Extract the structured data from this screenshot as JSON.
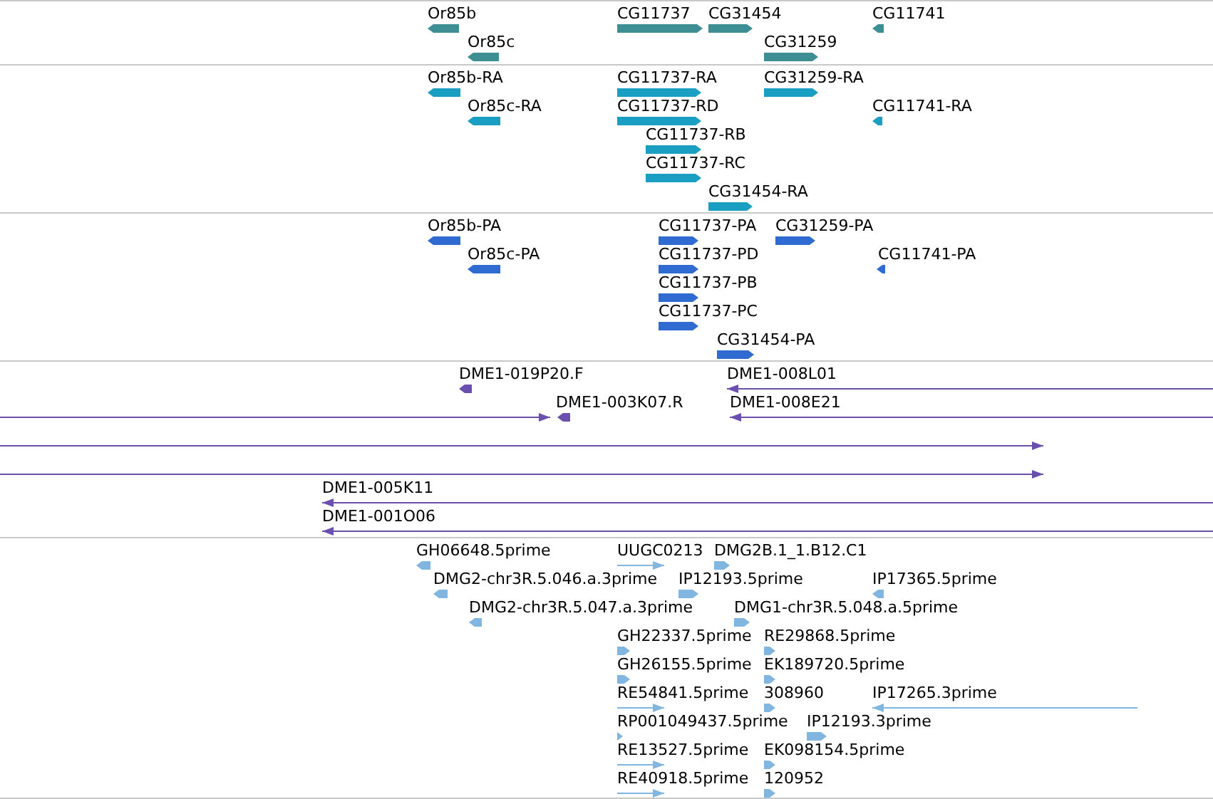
{
  "tracks": [
    {
      "kind": "gene",
      "features": [
        {
          "label": "Or85b",
          "kind": "block",
          "reverse": true
        },
        {
          "label": "Or85c",
          "kind": "block",
          "reverse": true
        },
        {
          "label": "CG11737",
          "kind": "block",
          "reverse": false
        },
        {
          "label": "CG31454",
          "kind": "block",
          "reverse": false
        },
        {
          "label": "CG31259",
          "kind": "block",
          "reverse": false
        },
        {
          "label": "CG11741",
          "kind": "block",
          "reverse": true
        }
      ]
    },
    {
      "kind": "transcript",
      "features": [
        {
          "label": "Or85b-RA",
          "kind": "block",
          "reverse": true
        },
        {
          "label": "CG11737-RA",
          "kind": "block",
          "reverse": false
        },
        {
          "label": "CG31259-RA",
          "kind": "block",
          "reverse": false
        },
        {
          "label": "Or85c-RA",
          "kind": "block",
          "reverse": true
        },
        {
          "label": "CG11737-RD",
          "kind": "block",
          "reverse": false
        },
        {
          "label": "CG11741-RA",
          "kind": "block",
          "reverse": true
        },
        {
          "label": "CG11737-RB",
          "kind": "block",
          "reverse": false
        },
        {
          "label": "CG11737-RC",
          "kind": "block",
          "reverse": false
        },
        {
          "label": "CG31454-RA",
          "kind": "block",
          "reverse": false
        }
      ]
    },
    {
      "kind": "protein",
      "features": [
        {
          "label": "Or85b-PA",
          "kind": "block",
          "reverse": true
        },
        {
          "label": "CG11737-PA",
          "kind": "block",
          "reverse": false
        },
        {
          "label": "CG31259-PA",
          "kind": "block",
          "reverse": false
        },
        {
          "label": "Or85c-PA",
          "kind": "block",
          "reverse": true
        },
        {
          "label": "CG11737-PD",
          "kind": "block",
          "reverse": false
        },
        {
          "label": "CG11741-PA",
          "kind": "block",
          "reverse": true
        },
        {
          "label": "CG11737-PB",
          "kind": "block",
          "reverse": false
        },
        {
          "label": "CG11737-PC",
          "kind": "block",
          "reverse": false
        },
        {
          "label": "CG31454-PA",
          "kind": "block",
          "reverse": false
        }
      ]
    },
    {
      "kind": "clone",
      "features": [
        {
          "label": "DME1-019P20.F",
          "kind": "block",
          "reverse": true
        },
        {
          "label": "DME1-008L01",
          "kind": "line",
          "reverse": true
        },
        {
          "kind": "line",
          "reverse": false
        },
        {
          "label": "DME1-003K07.R",
          "kind": "block",
          "reverse": true
        },
        {
          "label": "DME1-008E21",
          "kind": "line",
          "reverse": true
        },
        {
          "kind": "line",
          "reverse": false
        },
        {
          "kind": "line",
          "reverse": false
        },
        {
          "label": "DME1-005K11",
          "kind": "line",
          "reverse": true
        },
        {
          "label": "DME1-001O06",
          "kind": "line",
          "reverse": true
        }
      ]
    },
    {
      "kind": "est",
      "features": [
        {
          "label": "GH06648.5prime",
          "kind": "block",
          "reverse": true
        },
        {
          "label": "UUGC0213",
          "kind": "line",
          "reverse": false
        },
        {
          "label": "DMG2B.1_1.B12.C1",
          "kind": "block",
          "reverse": false
        },
        {
          "label": "DMG2-chr3R.5.046.a.3prime",
          "kind": "block",
          "reverse": true
        },
        {
          "label": "IP12193.5prime",
          "kind": "block",
          "reverse": false
        },
        {
          "label": "IP17365.5prime",
          "kind": "block",
          "reverse": true
        },
        {
          "label": "DMG2-chr3R.5.047.a.3prime",
          "kind": "block",
          "reverse": true
        },
        {
          "label": "DMG1-chr3R.5.048.a.5prime",
          "kind": "block",
          "reverse": false
        },
        {
          "label": "GH22337.5prime",
          "kind": "block",
          "reverse": false
        },
        {
          "label": "RE29868.5prime",
          "kind": "block",
          "reverse": false
        },
        {
          "label": "GH26155.5prime",
          "kind": "block",
          "reverse": false
        },
        {
          "label": "EK189720.5prime",
          "kind": "block",
          "reverse": false
        },
        {
          "label": "RE54841.5prime",
          "kind": "line",
          "reverse": false
        },
        {
          "label": "308960",
          "kind": "block",
          "reverse": false
        },
        {
          "label": "IP17265.3prime",
          "kind": "line",
          "reverse": true
        },
        {
          "label": "RP001049437.5prime",
          "kind": "block",
          "reverse": false
        },
        {
          "label": "IP12193.3prime",
          "kind": "block",
          "reverse": false
        },
        {
          "label": "RE13527.5prime",
          "kind": "line",
          "reverse": false
        },
        {
          "label": "EK098154.5prime",
          "kind": "block",
          "reverse": false
        },
        {
          "label": "RE40918.5prime",
          "kind": "line",
          "reverse": false
        },
        {
          "label": "120952",
          "kind": "block",
          "reverse": false
        }
      ]
    }
  ]
}
